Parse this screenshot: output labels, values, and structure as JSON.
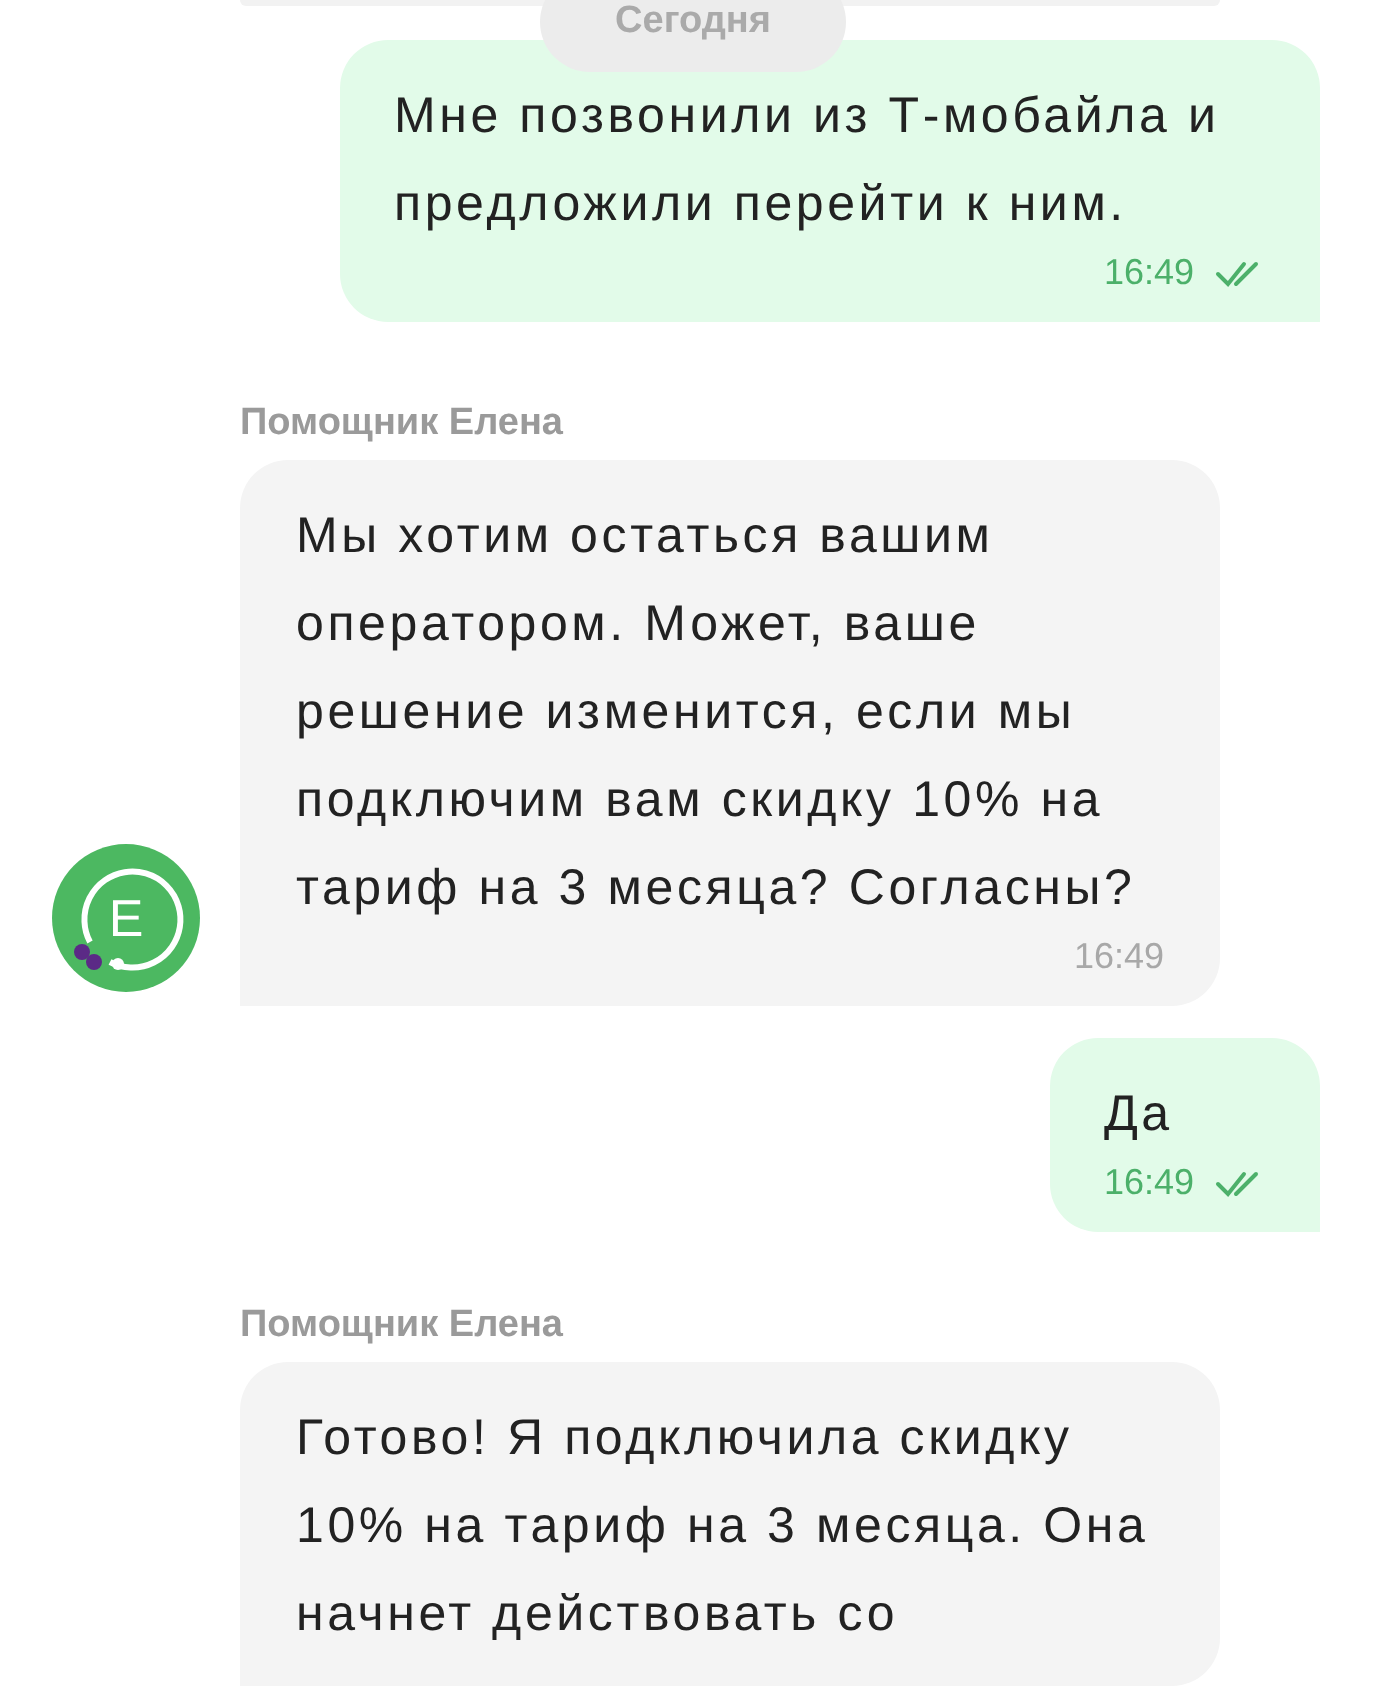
{
  "date_divider": "Сегодня",
  "messages": [
    {
      "kind": "outgoing",
      "text": "Мне позвонили из Т-мобайла и предложили перейти к ним.",
      "time": "16:49",
      "read": true
    },
    {
      "kind": "incoming",
      "sender": "Помощник Елена",
      "text": "Мы хотим остаться вашим оператором. Может, ваше решение изменится, если мы подключим вам скидку 10% на тариф на 3 месяца? Согласны?",
      "time": "16:49",
      "avatar": "Е"
    },
    {
      "kind": "outgoing",
      "text": "Да",
      "time": "16:49",
      "read": true
    },
    {
      "kind": "incoming",
      "sender": "Помощник Елена",
      "text": "Готово! Я подключила скидку 10% на тариф на 3 месяца. Она начнет действовать со"
    }
  ]
}
